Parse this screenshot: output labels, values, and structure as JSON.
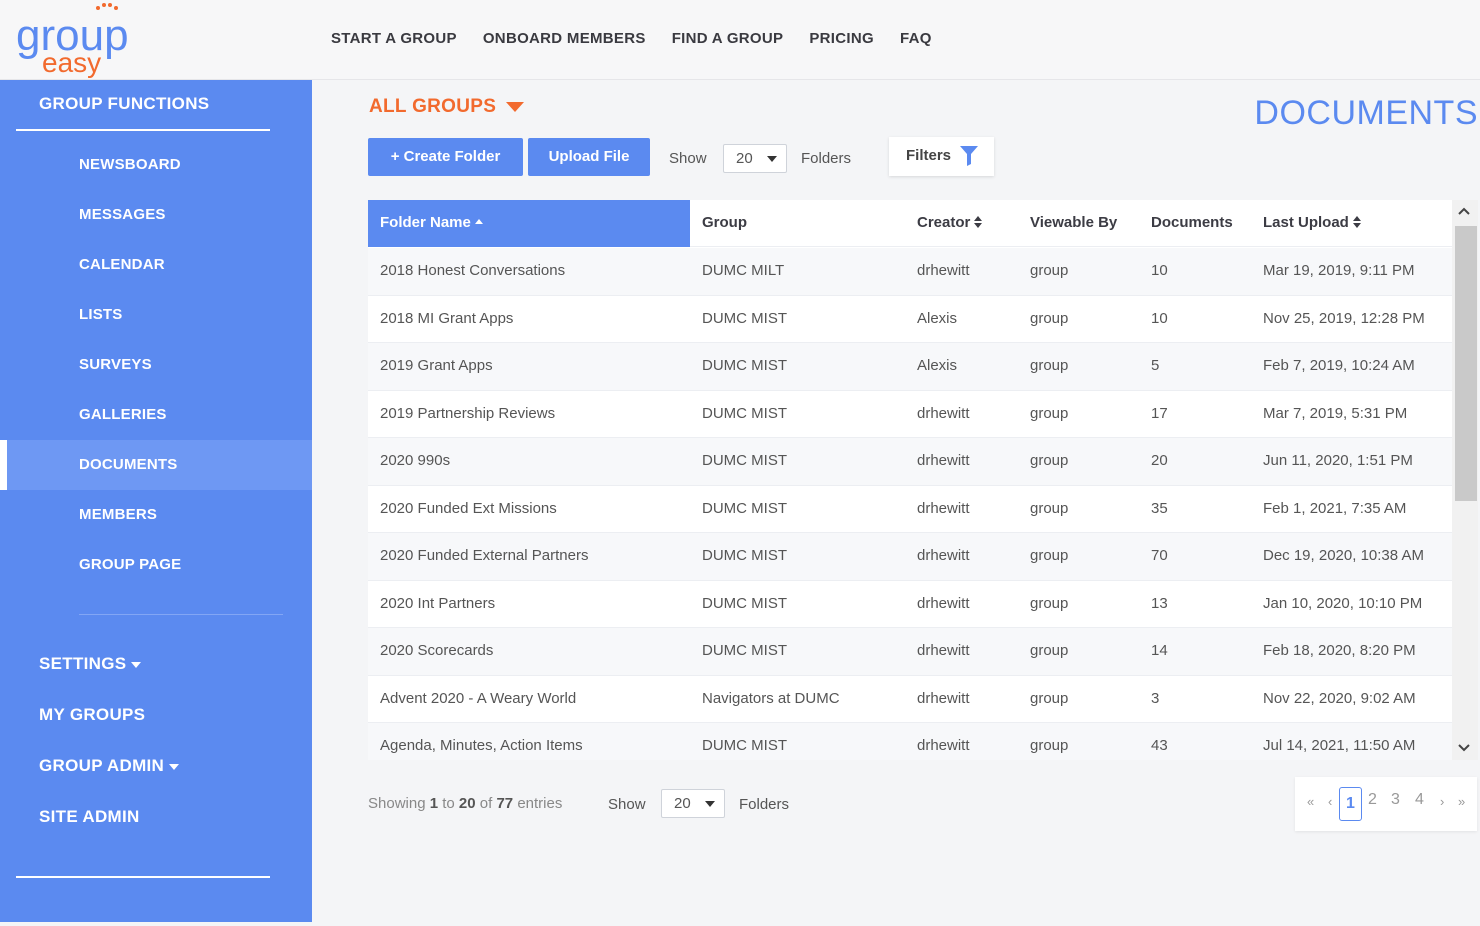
{
  "brand": {
    "logo_text_top": "group",
    "logo_text_bottom": "easy"
  },
  "topnav": [
    "START A GROUP",
    "ONBOARD MEMBERS",
    "FIND A GROUP",
    "PRICING",
    "FAQ"
  ],
  "sidebar": {
    "title": "GROUP FUNCTIONS",
    "items": [
      {
        "label": "NEWSBOARD"
      },
      {
        "label": "MESSAGES"
      },
      {
        "label": "CALENDAR"
      },
      {
        "label": "LISTS"
      },
      {
        "label": "SURVEYS"
      },
      {
        "label": "GALLERIES"
      },
      {
        "label": "DOCUMENTS",
        "active": true
      },
      {
        "label": "MEMBERS"
      },
      {
        "label": "GROUP PAGE"
      }
    ],
    "settings": "SETTINGS",
    "my_groups": "MY GROUPS",
    "group_admin": "GROUP ADMIN",
    "site_admin": "SITE ADMIN"
  },
  "main": {
    "group_selector": "ALL GROUPS",
    "heading": "DOCUMENTS",
    "create_folder": "+ Create Folder",
    "upload_file": "Upload File",
    "show_label": "Show",
    "show_value": "20",
    "folders_label": "Folders",
    "filters_label": "Filters"
  },
  "table": {
    "columns": [
      "Folder Name",
      "Group",
      "Creator",
      "Viewable By",
      "Documents",
      "Last Upload"
    ],
    "rows": [
      [
        "2018 Honest Conversations",
        "DUMC MILT",
        "drhewitt",
        "group",
        "10",
        "Mar 19, 2019, 9:11 PM"
      ],
      [
        "2018 MI Grant Apps",
        "DUMC MIST",
        "Alexis",
        "group",
        "10",
        "Nov 25, 2019, 12:28 PM"
      ],
      [
        "2019 Grant Apps",
        "DUMC MIST",
        "Alexis",
        "group",
        "5",
        "Feb 7, 2019, 10:24 AM"
      ],
      [
        "2019 Partnership Reviews",
        "DUMC MIST",
        "drhewitt",
        "group",
        "17",
        "Mar 7, 2019, 5:31 PM"
      ],
      [
        "2020 990s",
        "DUMC MIST",
        "drhewitt",
        "group",
        "20",
        "Jun 11, 2020, 1:51 PM"
      ],
      [
        "2020 Funded Ext Missions",
        "DUMC MIST",
        "drhewitt",
        "group",
        "35",
        "Feb 1, 2021, 7:35 AM"
      ],
      [
        "2020 Funded External Partners",
        "DUMC MIST",
        "drhewitt",
        "group",
        "70",
        "Dec 19, 2020, 10:38 AM"
      ],
      [
        "2020 Int Partners",
        "DUMC MIST",
        "drhewitt",
        "group",
        "13",
        "Jan 10, 2020, 10:10 PM"
      ],
      [
        "2020 Scorecards",
        "DUMC MIST",
        "drhewitt",
        "group",
        "14",
        "Feb 18, 2020, 8:20 PM"
      ],
      [
        "Advent 2020 - A Weary World",
        "Navigators at DUMC",
        "drhewitt",
        "group",
        "3",
        "Nov 22, 2020, 9:02 AM"
      ],
      [
        "Agenda, Minutes, Action Items",
        "DUMC MIST",
        "drhewitt",
        "group",
        "43",
        "Jul 14, 2021, 11:50 AM"
      ]
    ]
  },
  "footer": {
    "showing": "Showing",
    "from": "1",
    "to_word": "to",
    "to": "20",
    "of_word": "of",
    "total": "77",
    "entries": "entries",
    "show_label": "Show",
    "show_value": "20",
    "folders_label": "Folders"
  },
  "pagination": {
    "first": "«",
    "prev": "‹",
    "pages": [
      "1",
      "2",
      "3",
      "4"
    ],
    "current": "1",
    "next": "›",
    "last": "»"
  },
  "colors": {
    "primary": "#5b8af0",
    "accent": "#f26a2e",
    "sidebar_active": "#6e98f3"
  }
}
